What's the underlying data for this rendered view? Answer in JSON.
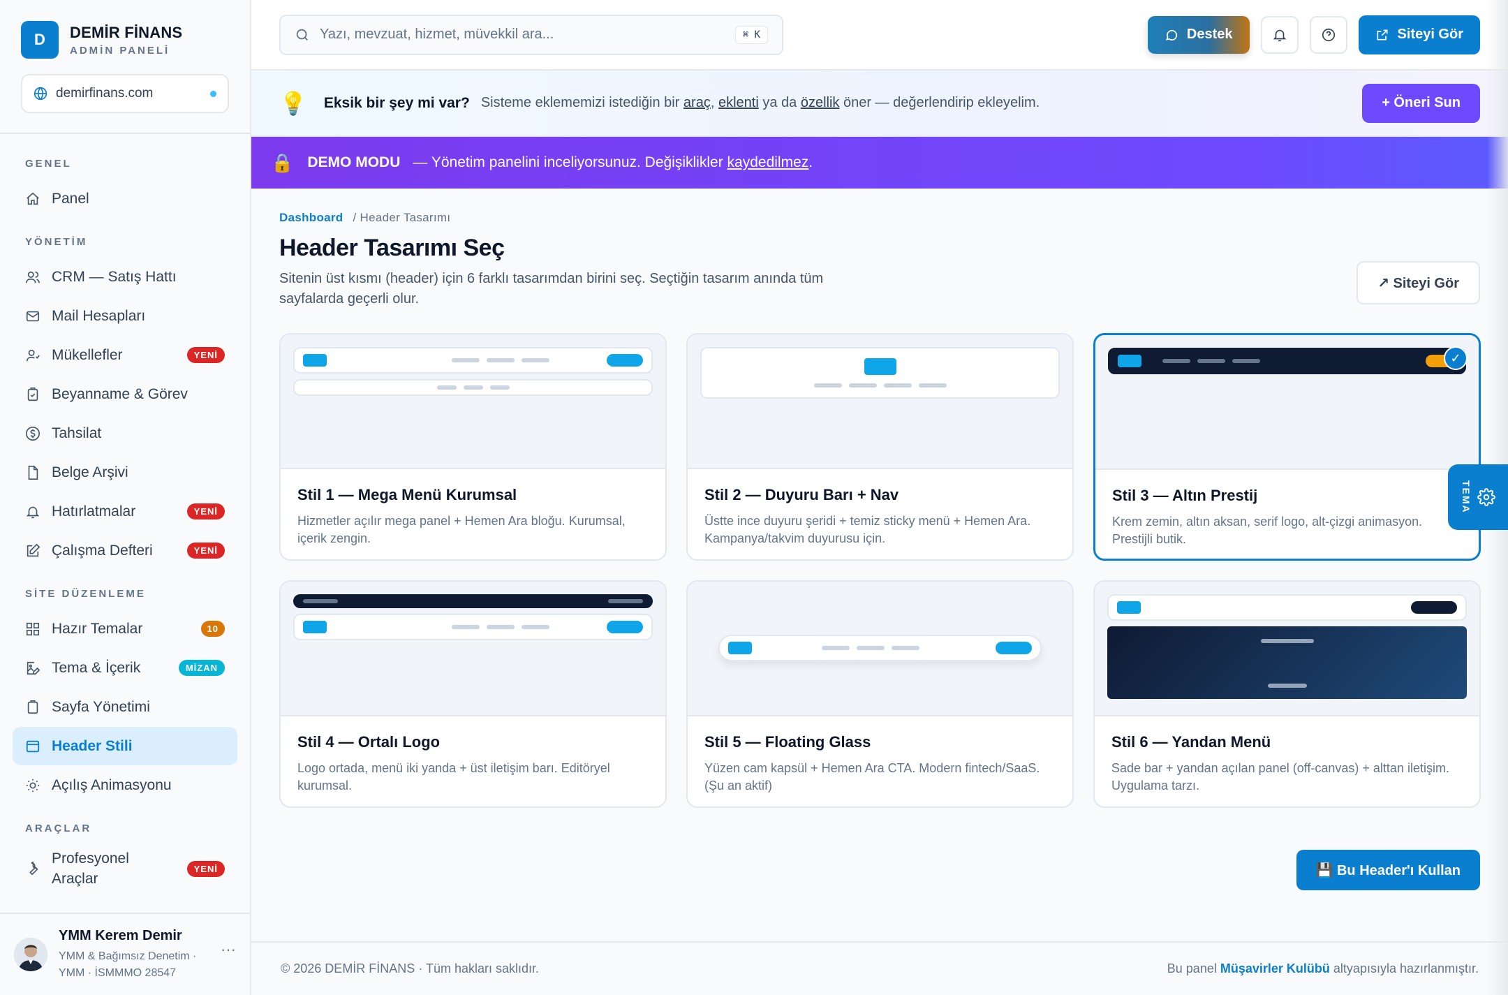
{
  "brand": {
    "logo_letter": "D",
    "name": "DEMİR FİNANS",
    "subtitle": "ADMİN PANELİ",
    "site": "demirfinans.com"
  },
  "sidebar": {
    "sections": [
      {
        "title": "GENEL",
        "items": [
          {
            "label": "Panel",
            "icon": "home-icon"
          }
        ]
      },
      {
        "title": "YÖNETİM",
        "items": [
          {
            "label": "CRM — Satış Hattı",
            "icon": "users-icon"
          },
          {
            "label": "Mail Hesapları",
            "icon": "mail-icon"
          },
          {
            "label": "Mükellefler",
            "icon": "contacts-icon",
            "badge": "YENİ"
          },
          {
            "label": "Beyanname & Görev",
            "icon": "clipboard-icon"
          },
          {
            "label": "Tahsilat",
            "icon": "dollar-icon"
          },
          {
            "label": "Belge Arşivi",
            "icon": "file-icon"
          },
          {
            "label": "Hatırlatmalar",
            "icon": "bell-icon",
            "badge": "YENİ"
          },
          {
            "label": "Çalışma Defteri",
            "icon": "edit-icon",
            "badge": "YENİ"
          }
        ]
      },
      {
        "title": "SİTE DÜZENLEME",
        "items": [
          {
            "label": "Hazır Temalar",
            "icon": "grid-icon",
            "badge": "10"
          },
          {
            "label": "Tema & İçerik",
            "icon": "image-edit-icon",
            "badge": "MİZAN"
          },
          {
            "label": "Sayfa Yönetimi",
            "icon": "pages-icon"
          },
          {
            "label": "Header Stili",
            "icon": "layout-icon",
            "active": true
          },
          {
            "label": "Açılış Animasyonu",
            "icon": "sun-icon"
          }
        ]
      },
      {
        "title": "ARAÇLAR",
        "items": [
          {
            "label": "Profesyonel Araçlar",
            "icon": "wrench-icon",
            "badge": "YENİ"
          }
        ]
      }
    ]
  },
  "user": {
    "name": "YMM Kerem Demir",
    "role_line1": "YMM & Bağımsız Denetim ·",
    "role_line2": "YMM · İSMMMO 28547",
    "more": "···"
  },
  "topbar": {
    "search_placeholder": "Yazı, mevzuat, hizmet, müvekkil ara...",
    "shortcut": "⌘ K",
    "support_label": "Destek",
    "view_site_label": "Siteyi Gör"
  },
  "suggest": {
    "icon": "💡",
    "title": "Eksik bir şey mi var?",
    "text_before": "Sisteme eklememizi istediğin bir",
    "link1": "araç",
    "sep1": ",",
    "link2": "eklenti",
    "mid": "ya da",
    "link3": "özellik",
    "text_after": "öner — değerlendirip ekleyelim.",
    "button": "+ Öneri Sun"
  },
  "demo": {
    "icon": "🔒",
    "title": "DEMO MODU",
    "text": "— Yönetim panelini inceliyorsunuz. Değişiklikler",
    "link": "kaydedilmez",
    "end": "."
  },
  "breadcrumb": {
    "home": "Dashboard",
    "current": "/ Header Tasarımı"
  },
  "page": {
    "title": "Header Tasarımı Seç",
    "subtitle": "Sitenin üst kısmı (header) için 6 farklı tasarımdan birini seç. Seçtiğin tasarım anında tüm sayfalarda geçerli olur.",
    "view_site": "↗ Siteyi Gör",
    "apply_button": "💾 Bu Header'ı Kullan"
  },
  "styles": [
    {
      "name": "Stil 1 — Mega Menü Kurumsal",
      "desc": "Hizmetler açılır mega panel + Hemen Ara bloğu. Kurumsal, içerik zengin."
    },
    {
      "name": "Stil 2 — Duyuru Barı + Nav",
      "desc": "Üstte ince duyuru şeridi + temiz sticky menü + Hemen Ara. Kampanya/takvim duyurusu için."
    },
    {
      "name": "Stil 3 — Altın Prestij",
      "desc": "Krem zemin, altın aksan, serif logo, alt-çizgi animasyon. Prestijli butik.",
      "selected": true
    },
    {
      "name": "Stil 4 — Ortalı Logo",
      "desc": "Logo ortada, menü iki yanda + üst iletişim barı. Editöryel kurumsal."
    },
    {
      "name": "Stil 5 — Floating Glass",
      "desc": "Yüzen cam kapsül + Hemen Ara CTA. Modern fintech/SaaS. (Şu an aktif)"
    },
    {
      "name": "Stil 6 — Yandan Menü",
      "desc": "Sade bar + yandan açılan panel (off-canvas) + alttan iletişim. Uygulama tarzı."
    }
  ],
  "selected_check": "✓",
  "theme_tab": "TEMA",
  "footer": {
    "left": "© 2026 DEMİR FİNANS · Tüm hakları saklıdır.",
    "right_before": "Bu panel",
    "right_link": "Müşavirler Kulübü",
    "right_after": "altyapısıyla hazırlanmıştır."
  },
  "colors": {
    "primary": "#0a7fd0",
    "violet": "#6d4aff",
    "danger": "#dc2626",
    "navy": "#0f1a33",
    "gold": "#f59e0b"
  }
}
